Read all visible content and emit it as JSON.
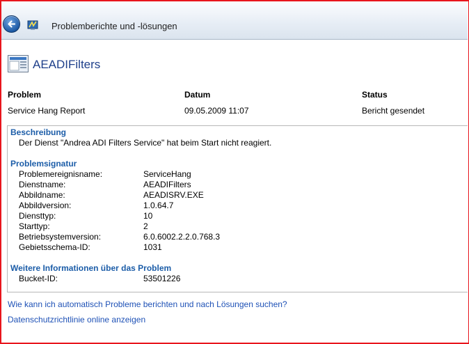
{
  "window": {
    "title": "Problemberichte und -lösungen"
  },
  "report": {
    "app_name": "AEADIFilters"
  },
  "summary": {
    "headers": {
      "problem": "Problem",
      "date": "Datum",
      "status": "Status"
    },
    "values": {
      "problem": "Service Hang Report",
      "date": "09.05.2009 11:07",
      "status": "Bericht gesendet"
    }
  },
  "description": {
    "title": "Beschreibung",
    "text": "Der Dienst \"Andrea ADI Filters Service\" hat beim Start nicht reagiert."
  },
  "signature": {
    "title": "Problemsignatur",
    "rows": [
      {
        "label": "Problemereignisname:",
        "value": "ServiceHang"
      },
      {
        "label": "Dienstname:",
        "value": "AEADIFilters"
      },
      {
        "label": "Abbildname:",
        "value": "AEADISRV.EXE"
      },
      {
        "label": "Abbildversion:",
        "value": "1.0.64.7"
      },
      {
        "label": "Diensttyp:",
        "value": "10"
      },
      {
        "label": "Starttyp:",
        "value": "2"
      },
      {
        "label": "Betriebsystemversion:",
        "value": "6.0.6002.2.2.0.768.3"
      },
      {
        "label": "Gebietsschema-ID:",
        "value": "1031"
      }
    ]
  },
  "more_info": {
    "title": "Weitere Informationen über das Problem",
    "rows": [
      {
        "label": "Bucket-ID:",
        "value": "53501226"
      }
    ]
  },
  "links": {
    "auto_report": "Wie kann ich automatisch Probleme berichten und nach Lösungen suchen?",
    "privacy": "Datenschutzrichtlinie online anzeigen"
  },
  "icons": {
    "back": "back-arrow-icon",
    "app": "problem-reports-icon",
    "report": "report-document-icon"
  },
  "colors": {
    "frame": "#e8151d",
    "section_title": "#1c5da8",
    "link": "#1e51b6"
  }
}
